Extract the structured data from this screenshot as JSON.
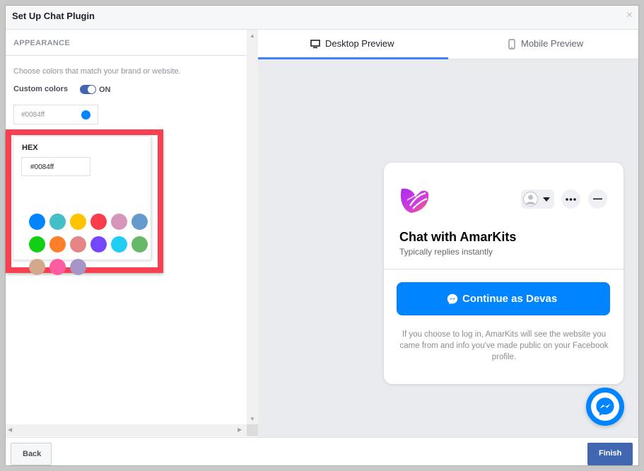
{
  "dialog": {
    "title": "Set Up Chat Plugin",
    "close_glyph": "×"
  },
  "left": {
    "section_title": "APPEARANCE",
    "description": "Choose colors that match your brand or website.",
    "custom_colors_label": "Custom colors",
    "toggle_state": "ON",
    "selected_color_value": "#0084ff",
    "picker": {
      "hex_label": "HEX",
      "hex_value": "#0084ff",
      "swatches": [
        "#0084ff",
        "#44bec7",
        "#ffc300",
        "#fa3c4c",
        "#d696bb",
        "#6699cc",
        "#13cf13",
        "#ff7e29",
        "#e68585",
        "#7646ff",
        "#20cef5",
        "#67b868",
        "#d4a88c",
        "#ff5ca1",
        "#a695c7"
      ]
    }
  },
  "right": {
    "tabs": [
      {
        "label": "Desktop Preview",
        "icon": "desktop-icon",
        "active": true
      },
      {
        "label": "Mobile Preview",
        "icon": "mobile-icon",
        "active": false
      }
    ],
    "card": {
      "title": "Chat with AmarKits",
      "subtitle": "Typically replies instantly",
      "continue_label": "Continue as Devas",
      "notice": "If you choose to log in, AmarKits will see the website you came from and info you've made public on your Facebook profile."
    }
  },
  "footer": {
    "back_label": "Back",
    "finish_label": "Finish"
  },
  "colors": {
    "accent": "#4267b2",
    "messenger_blue": "#0084ff",
    "highlight_border": "#f74050"
  }
}
